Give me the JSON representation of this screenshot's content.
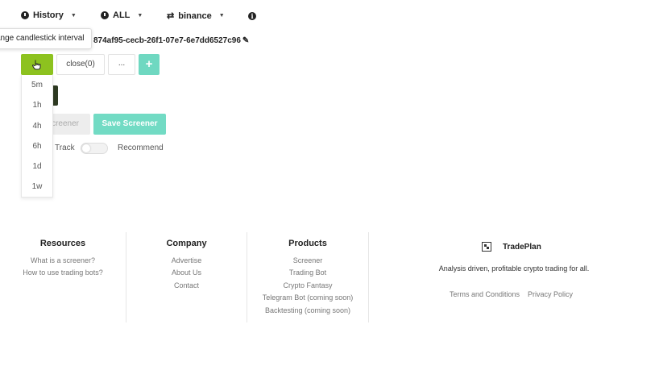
{
  "nav": {
    "history": "History",
    "all": "ALL",
    "exchange": "binance"
  },
  "tooltip": "ange candlestick interval",
  "screener_id": "874af95-cecb-26f1-07e7-6e7dd6527c96",
  "buttons": {
    "close": "close(0)",
    "more": "...",
    "plus": "+",
    "load": "creener",
    "save": "Save Screener"
  },
  "interval_options": [
    "5m",
    "1h",
    "4h",
    "6h",
    "1d",
    "1w"
  ],
  "toggle": {
    "track": "Track",
    "recommend": "Recommend"
  },
  "footer": {
    "resources": {
      "title": "Resources",
      "links": [
        "What is a screener?",
        "How to use trading bots?"
      ]
    },
    "company": {
      "title": "Company",
      "links": [
        "Advertise",
        "About Us",
        "Contact"
      ]
    },
    "products": {
      "title": "Products",
      "links": [
        "Screener",
        "Trading Bot",
        "Crypto Fantasy",
        "Telegram Bot (coming soon)",
        "Backtesting (coming soon)"
      ]
    },
    "brand": {
      "name": "TradePlan",
      "tagline": "Analysis driven, profitable crypto trading for all.",
      "terms": "Terms and Conditions",
      "privacy": "Privacy Policy"
    }
  },
  "colors": {
    "accent_green": "#8dc21f",
    "accent_teal": "#72dbc4"
  }
}
